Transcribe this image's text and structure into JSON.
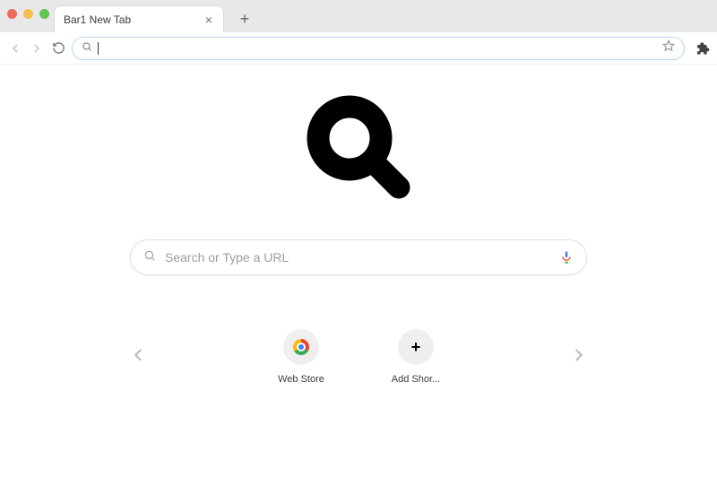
{
  "chrome": {
    "tab_title": "Bar1 New Tab",
    "omnibox_value": ""
  },
  "page": {
    "search_placeholder": "Search or Type a URL"
  },
  "shortcuts": [
    {
      "label": "Web Store"
    },
    {
      "label": "Add Shor..."
    }
  ]
}
